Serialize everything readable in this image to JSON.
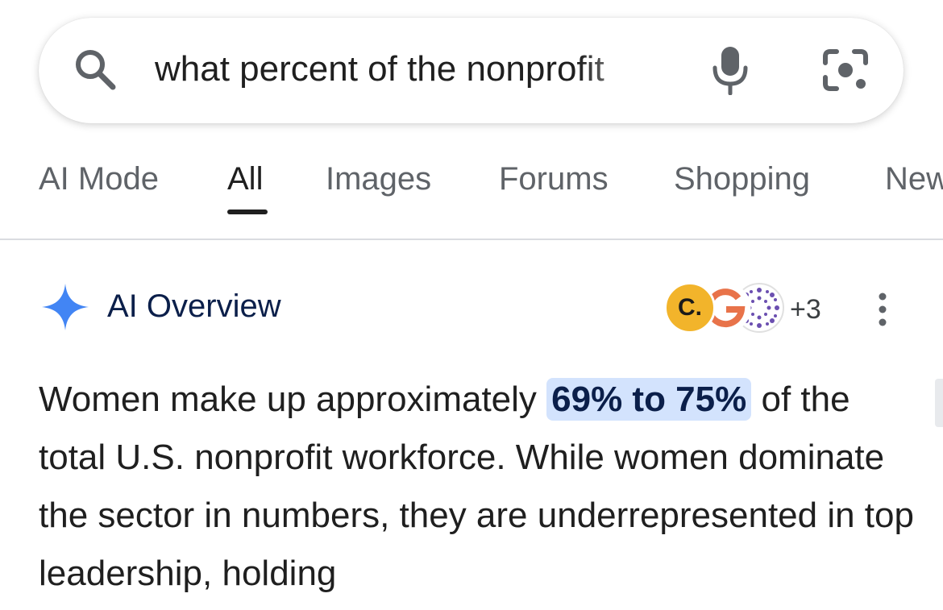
{
  "search": {
    "query": "what percent of the nonprofit",
    "icons": [
      "search-icon",
      "mic-icon",
      "lens-icon"
    ]
  },
  "tabs": [
    {
      "label": "AI Mode"
    },
    {
      "label": "All",
      "active": true
    },
    {
      "label": "Images"
    },
    {
      "label": "Forums"
    },
    {
      "label": "Shopping"
    },
    {
      "label": "New"
    }
  ],
  "ai_overview": {
    "title": "AI Overview",
    "sources": {
      "first_badge": "C.",
      "more_count": "+3"
    },
    "body": {
      "before": "Women make up approximately ",
      "highlight": "69% to 75%",
      "after": " of the total U.S. nonprofit workforce. While women dominate the sector in numbers, they are underrepresented in top leadership, holding"
    }
  },
  "colors": {
    "highlight_bg": "#d3e3fd",
    "sparkle": "#4285f4",
    "source_c": "#f2b42b"
  }
}
